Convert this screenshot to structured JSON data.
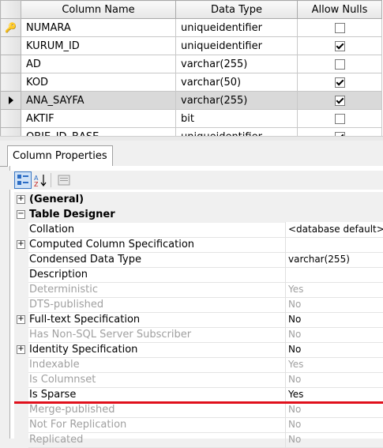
{
  "grid": {
    "headers": [
      "Column Name",
      "Data Type",
      "Allow Nulls"
    ],
    "rows": [
      {
        "name": "NUMARA",
        "type": "uniqueidentifier",
        "allow_nulls": false,
        "key": true
      },
      {
        "name": "KURUM_ID",
        "type": "uniqueidentifier",
        "allow_nulls": true
      },
      {
        "name": "AD",
        "type": "varchar(255)",
        "allow_nulls": false
      },
      {
        "name": "KOD",
        "type": "varchar(50)",
        "allow_nulls": true
      },
      {
        "name": "ANA_SAYFA",
        "type": "varchar(255)",
        "allow_nulls": true,
        "current": true
      },
      {
        "name": "AKTIF",
        "type": "bit",
        "allow_nulls": false
      },
      {
        "name": "OBJE_ID_BASE",
        "type": "uniqueidentifier",
        "allow_nulls": true
      }
    ]
  },
  "panel": {
    "tab_label": "Column Properties"
  },
  "properties": [
    {
      "type": "cat",
      "expand": "+",
      "name": "(General)"
    },
    {
      "type": "cat",
      "expand": "−",
      "name": "Table Designer"
    },
    {
      "name": "Collation",
      "value": "<database default>"
    },
    {
      "expand": "+",
      "name": "Computed Column Specification",
      "value": ""
    },
    {
      "name": "Condensed Data Type",
      "value": "varchar(255)"
    },
    {
      "name": "Description",
      "value": ""
    },
    {
      "name": "Deterministic",
      "value": "Yes",
      "disabled": true
    },
    {
      "name": "DTS-published",
      "value": "No",
      "disabled": true
    },
    {
      "expand": "+",
      "name": "Full-text Specification",
      "value": "No"
    },
    {
      "name": "Has Non-SQL Server Subscriber",
      "value": "No",
      "disabled": true
    },
    {
      "expand": "+",
      "name": "Identity Specification",
      "value": "No"
    },
    {
      "name": "Indexable",
      "value": "Yes",
      "disabled": true
    },
    {
      "name": "Is Columnset",
      "value": "No",
      "disabled": true
    },
    {
      "name": "Is Sparse",
      "value": "Yes"
    },
    {
      "name": "Merge-published",
      "value": "No",
      "disabled": true
    },
    {
      "name": "Not For Replication",
      "value": "No",
      "disabled": true
    },
    {
      "name": "Replicated",
      "value": "No",
      "disabled": true
    }
  ],
  "colors": {
    "highlight_line": "#e0101c",
    "current_row": "#d9d9d9"
  }
}
